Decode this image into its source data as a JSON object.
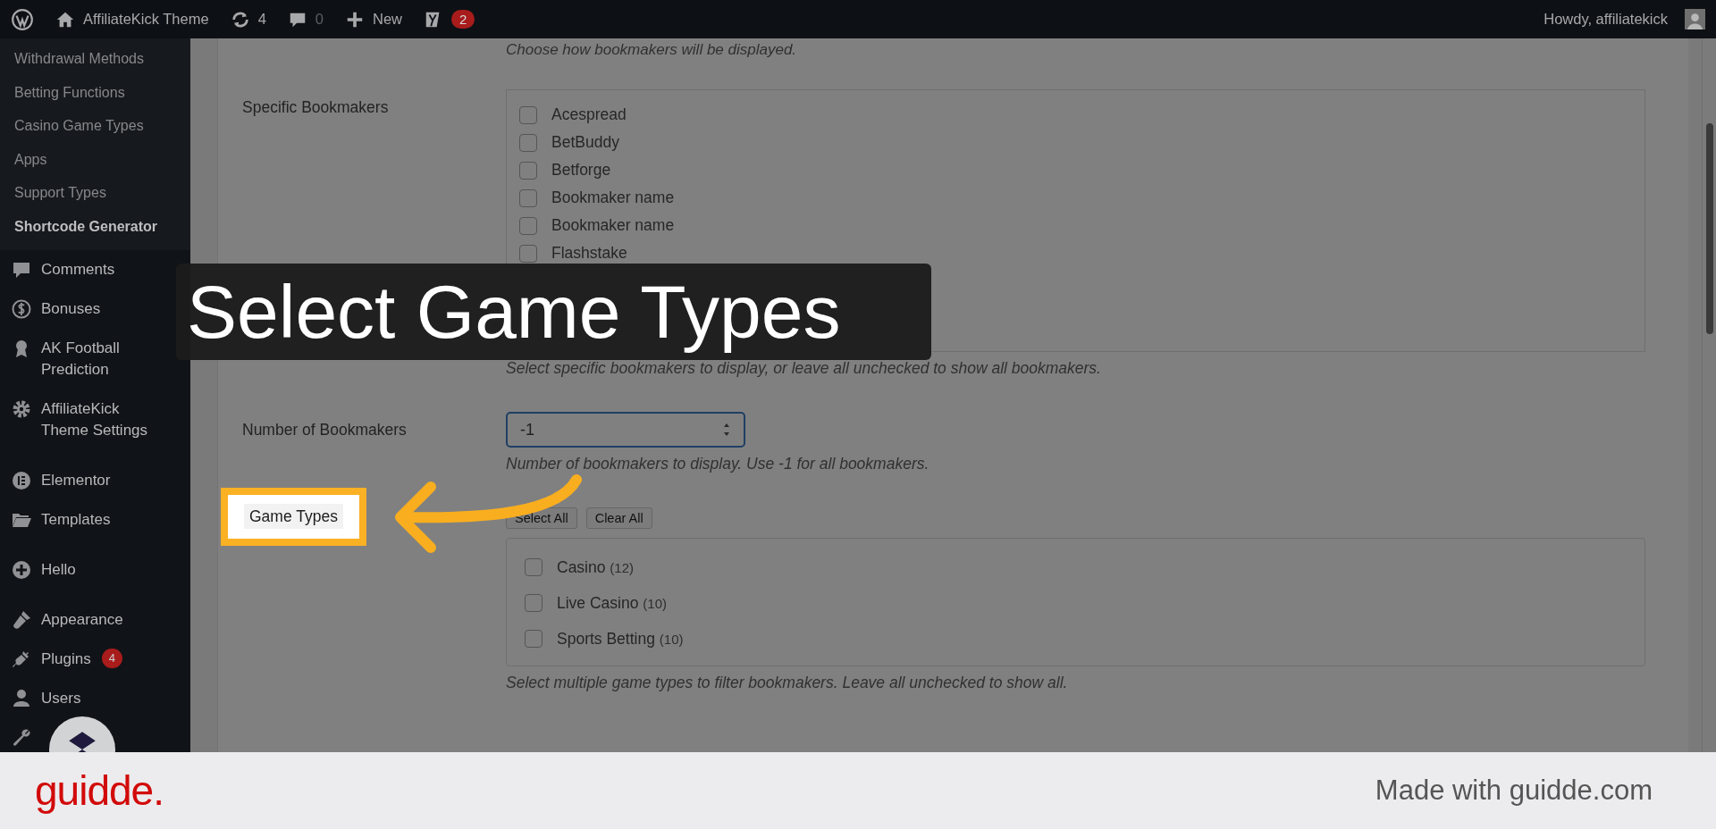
{
  "admin_bar": {
    "site_name": "AffiliateKick Theme",
    "updates": "4",
    "comments": "0",
    "new_label": "New",
    "seo_badge": "2",
    "greeting": "Howdy, affiliatekick"
  },
  "sidebar": {
    "submenu": [
      {
        "label": "Withdrawal Methods",
        "selected": false
      },
      {
        "label": "Betting Functions",
        "selected": false
      },
      {
        "label": "Casino Game Types",
        "selected": false
      },
      {
        "label": "Apps",
        "selected": false
      },
      {
        "label": "Support Types",
        "selected": false
      },
      {
        "label": "Shortcode Generator",
        "selected": true
      }
    ],
    "items": [
      {
        "label": "Comments"
      },
      {
        "label": "Bonuses"
      },
      {
        "label": "AK Football Prediction"
      },
      {
        "label": "AffiliateKick Theme Settings"
      },
      {
        "label": "Elementor"
      },
      {
        "label": "Templates"
      },
      {
        "label": "Hello"
      },
      {
        "label": "Appearance"
      },
      {
        "label": "Plugins",
        "badge": "4"
      },
      {
        "label": "Users"
      }
    ]
  },
  "top_help": "Choose how bookmakers will be displayed.",
  "settings": [
    {
      "kind": "checklist",
      "label": "Specific Bookmakers",
      "options": [
        {
          "label": "Acespread",
          "checked": false
        },
        {
          "label": "BetBuddy",
          "checked": false
        },
        {
          "label": "Betforge",
          "checked": false
        },
        {
          "label": "Bookmaker name",
          "checked": false
        },
        {
          "label": "Bookmaker name",
          "checked": false
        },
        {
          "label": "Flashstake",
          "checked": false
        }
      ],
      "help": "Select specific bookmakers to display, or leave all unchecked to show all bookmakers."
    },
    {
      "kind": "number",
      "label": "Number of Bookmakers",
      "value": "-1",
      "help": "Number of bookmakers to display. Use -1 for all bookmakers."
    },
    {
      "kind": "game_types",
      "label": "Game Types",
      "highlighted": true,
      "buttons": [
        "Select All",
        "Clear All"
      ],
      "options": [
        {
          "label": "Casino",
          "count": "(12)",
          "checked": false
        },
        {
          "label": "Live Casino",
          "count": "(10)",
          "checked": false
        },
        {
          "label": "Sports Betting",
          "count": "(10)",
          "checked": false
        }
      ],
      "help": "Select multiple game types to filter bookmakers. Leave all unchecked to show all."
    }
  ],
  "callout": {
    "text": "Select Game Types"
  },
  "footer": {
    "logo": "guidde.",
    "credit": "Made with guidde.com"
  }
}
